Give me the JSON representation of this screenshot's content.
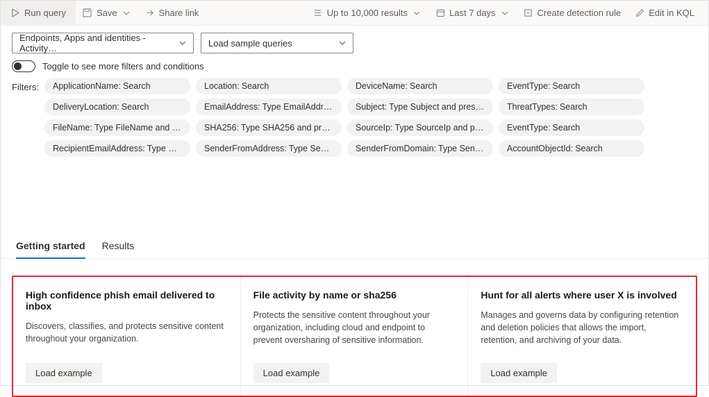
{
  "toolbar": {
    "run_label": "Run query",
    "save_label": "Save",
    "share_label": "Share link",
    "results_limit": "Up to 10,000 results",
    "time_range": "Last 7 days",
    "create_rule": "Create detection rule",
    "edit_kql": "Edit in KQL"
  },
  "selectors": {
    "scope": "Endpoints, Apps and identities - Activity…",
    "sample": "Load sample queries"
  },
  "toggle_text": "Toggle to see more filters and conditions",
  "filters_label": "Filters:",
  "filters": [
    {
      "name": "ApplicationName",
      "value": "Search"
    },
    {
      "name": "Location",
      "value": "Search"
    },
    {
      "name": "DeviceName",
      "value": "Search"
    },
    {
      "name": "EventType",
      "value": "Search"
    },
    {
      "name": "DeliveryLocation",
      "value": "Search"
    },
    {
      "name": "EmailAddress",
      "value": "Type EmailAddres…"
    },
    {
      "name": "Subject",
      "value": "Type Subject and press …"
    },
    {
      "name": "ThreatTypes",
      "value": "Search"
    },
    {
      "name": "FileName",
      "value": "Type FileName and pr…"
    },
    {
      "name": "SHA256",
      "value": "Type SHA256 and pres…"
    },
    {
      "name": "SourceIp",
      "value": "Type SourceIp and pre…"
    },
    {
      "name": "EventType",
      "value": "Search"
    },
    {
      "name": "RecipientEmailAddress",
      "value": "Type Rec…"
    },
    {
      "name": "SenderFromAddress",
      "value": "Type Send…"
    },
    {
      "name": "SenderFromDomain",
      "value": "Type Sende…"
    },
    {
      "name": "AccountObjectId",
      "value": "Search"
    }
  ],
  "tabs": {
    "getting_started": "Getting started",
    "results": "Results"
  },
  "cards": [
    {
      "title": "High confidence phish email delivered to inbox",
      "desc": "Discovers, classifies, and protects sensitive content throughout your organization.",
      "btn": "Load example"
    },
    {
      "title": "File activity by name or sha256",
      "desc": "Protects the sensitive content throughout your organization, including cloud and endpoint to prevent oversharing of sensitive information.",
      "btn": "Load example"
    },
    {
      "title": "Hunt for all alerts where user X is involved",
      "desc": "Manages and governs data by configuring retention and deletion policies that allows the import, retention, and archiving of your data.",
      "btn": "Load example"
    }
  ]
}
